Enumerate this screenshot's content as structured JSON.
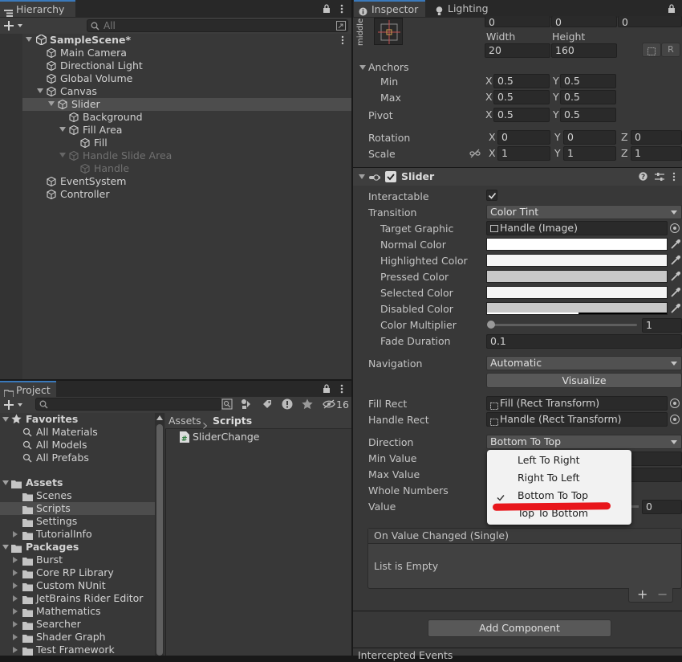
{
  "hierarchy": {
    "tab": "Hierarchy",
    "search_placeholder": "All",
    "scene": "SampleScene*",
    "items": [
      {
        "label": "Main Camera"
      },
      {
        "label": "Directional Light"
      },
      {
        "label": "Global Volume"
      },
      {
        "label": "Canvas"
      },
      {
        "label": "Slider"
      },
      {
        "label": "Background"
      },
      {
        "label": "Fill Area"
      },
      {
        "label": "Fill"
      },
      {
        "label": "Handle Slide Area"
      },
      {
        "label": "Handle"
      },
      {
        "label": "EventSystem"
      },
      {
        "label": "Controller"
      }
    ]
  },
  "project": {
    "tab": "Project",
    "hidden_count": "16",
    "favorites": {
      "label": "Favorites",
      "items": [
        "All Materials",
        "All Models",
        "All Prefabs"
      ]
    },
    "assets": {
      "label": "Assets",
      "items": [
        "Scenes",
        "Scripts",
        "Settings",
        "TutorialInfo"
      ]
    },
    "packages": {
      "label": "Packages",
      "items": [
        "Burst",
        "Core RP Library",
        "Custom NUnit",
        "JetBrains Rider Editor",
        "Mathematics",
        "Searcher",
        "Shader Graph",
        "Test Framework"
      ]
    },
    "breadcrumb": {
      "root": "Assets",
      "current": "Scripts"
    },
    "files": [
      {
        "label": "SliderChange"
      }
    ]
  },
  "inspector": {
    "tab": "Inspector",
    "tab2": "Lighting",
    "rect": {
      "pos_values": [
        "0",
        "0",
        "0"
      ],
      "anchor_preset": "middle",
      "width_label": "Width",
      "height_label": "Height",
      "width": "20",
      "height": "160",
      "r_label": "R",
      "anchors_label": "Anchors",
      "min_label": "Min",
      "max_label": "Max",
      "pivot_label": "Pivot",
      "min_x": "0.5",
      "min_y": "0.5",
      "max_x": "0.5",
      "max_y": "0.5",
      "pivot_x": "0.5",
      "pivot_y": "0.5",
      "rotation_label": "Rotation",
      "scale_label": "Scale",
      "rot": [
        "0",
        "0",
        "0"
      ],
      "scale": [
        "1",
        "1",
        "1"
      ],
      "x": "X",
      "y": "Y",
      "z": "Z"
    },
    "slider": {
      "title": "Slider",
      "interactable_label": "Interactable",
      "transition_label": "Transition",
      "transition": "Color Tint",
      "target_graphic_label": "Target Graphic",
      "target_graphic": "Handle (Image)",
      "normal_label": "Normal Color",
      "highlighted_label": "Highlighted Color",
      "pressed_label": "Pressed Color",
      "selected_label": "Selected Color",
      "disabled_label": "Disabled Color",
      "colors": {
        "normal": "#ffffff",
        "highlighted": "#f5f5f5",
        "pressed": "#c8c8c8",
        "selected": "#f5f5f5",
        "disabled": "#c8c8c8"
      },
      "multiplier_label": "Color Multiplier",
      "multiplier": "1",
      "fade_label": "Fade Duration",
      "fade": "0.1",
      "navigation_label": "Navigation",
      "navigation": "Automatic",
      "visualize": "Visualize",
      "fill_rect_label": "Fill Rect",
      "fill_rect": "Fill (Rect Transform)",
      "handle_rect_label": "Handle Rect",
      "handle_rect": "Handle (Rect Transform)",
      "direction_label": "Direction",
      "direction": "Bottom To Top",
      "min_value_label": "Min Value",
      "max_value_label": "Max Value",
      "whole_numbers_label": "Whole Numbers",
      "value_label": "Value",
      "value": "0",
      "event_label": "On Value Changed (Single)",
      "list_empty": "List is Empty"
    },
    "add_component": "Add Component",
    "bottom_cut": "Intercepted Events"
  },
  "direction_menu": {
    "options": [
      "Left To Right",
      "Right To Left",
      "Bottom To Top",
      "Top To Bottom"
    ],
    "selected": "Bottom To Top",
    "annotation_color": "#e8161b"
  }
}
